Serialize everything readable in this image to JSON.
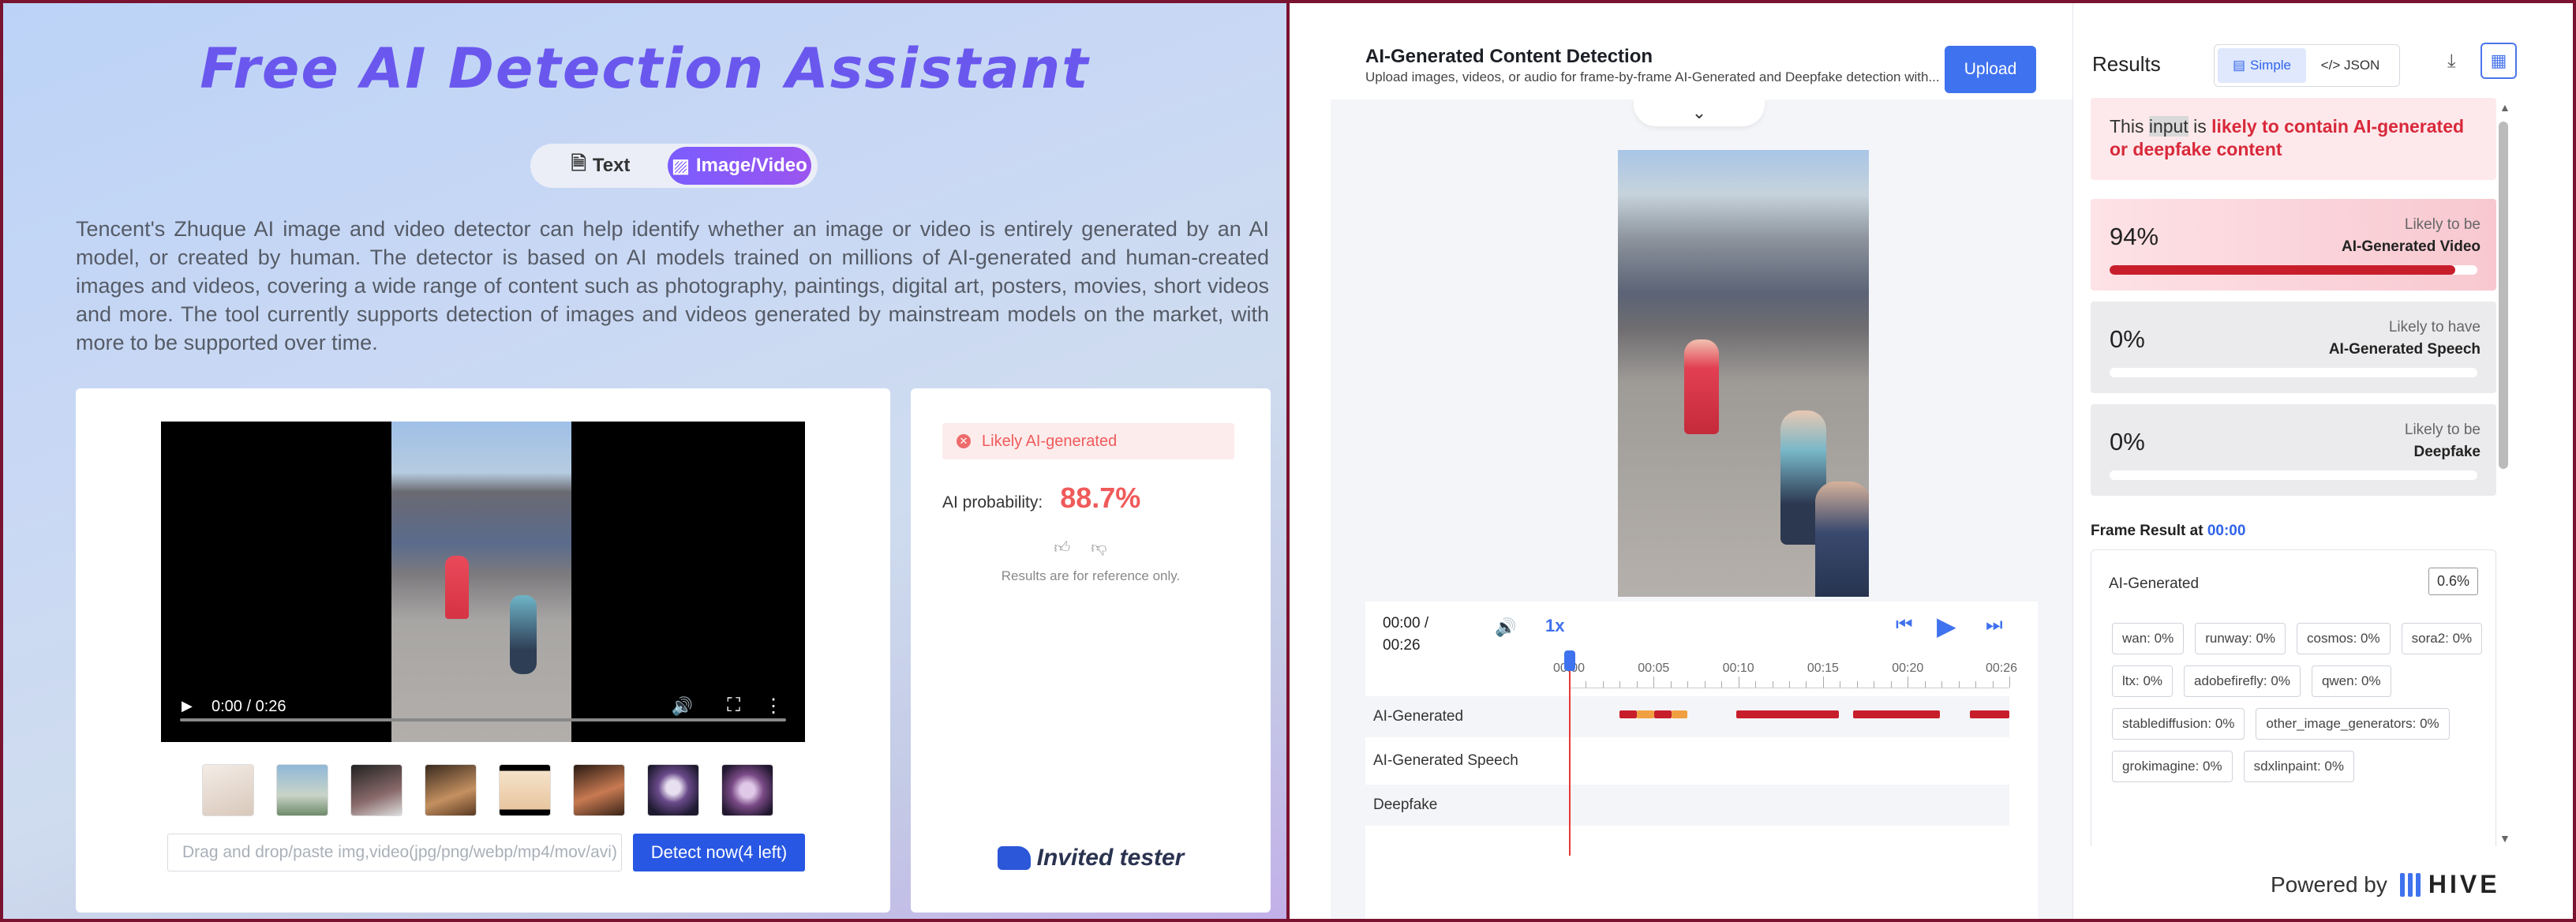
{
  "left": {
    "title": "Free AI Detection Assistant",
    "tabs": [
      {
        "label": "Text",
        "icon": "document-icon",
        "active": false
      },
      {
        "label": "Image/Video",
        "icon": "image-icon",
        "active": true
      }
    ],
    "description": "Tencent's Zhuque AI image and video detector can help identify whether an image or video is entirely generated by an AI model, or created by human. The detector is based on AI models trained on millions of AI-generated and human-created images and videos, covering a wide range of content such as photography, paintings, digital art, posters, movies, short videos and more. The tool currently supports detection of images and videos generated by mainstream models on the market, with more to be supported over time.",
    "video": {
      "time": "0:00 / 0:26"
    },
    "thumbnails_count": 8,
    "dropzone_placeholder": "Drag and drop/paste img,video(jpg/png/webp/mp4/mov/avi)",
    "detect_button": "Detect now(4 left)",
    "result": {
      "badge": "Likely AI-generated",
      "prob_label": "AI probability:",
      "prob_value": "88.7%",
      "note": "Results are for reference only.",
      "invited": "Invited tester"
    }
  },
  "right": {
    "app_title": "AI-Generated Content Detection",
    "app_subtitle": "Upload images, videos, or audio for frame-by-frame AI-Generated and Deepfake detection with...",
    "upload_button": "Upload",
    "player": {
      "time_current": "00:00 /",
      "time_total": "00:26",
      "speed": "1x",
      "ticks": [
        "00:00",
        "00:05",
        "00:10",
        "00:15",
        "00:20",
        "00:26"
      ],
      "tracks": [
        "AI-Generated",
        "AI-Generated Speech",
        "Deepfake"
      ]
    },
    "results": {
      "title": "Results",
      "toggle": [
        "Simple",
        "</> JSON"
      ],
      "verdict_pre": "This ",
      "verdict_hl": "input",
      "verdict_mid": " is ",
      "verdict_red": "likely to contain AI-generated or deepfake content",
      "metrics": [
        {
          "value": "94%",
          "line1": "Likely to be",
          "line2": "AI-Generated Video",
          "fraction": 0.94
        },
        {
          "value": "0%",
          "line1": "Likely to have",
          "line2": "AI-Generated Speech",
          "fraction": 0
        },
        {
          "value": "0%",
          "line1": "Likely to be",
          "line2": "Deepfake",
          "fraction": 0
        }
      ],
      "frame_label": "Frame Result at ",
      "frame_time": "00:00",
      "frame_box_title": "AI-Generated",
      "frame_box_value": "0.6%",
      "chips": [
        "wan: 0%",
        "runway: 0%",
        "cosmos: 0%",
        "sora2: 0%",
        "ltx: 0%",
        "adobefirefly: 0%",
        "qwen: 0%",
        "stablediffusion: 0%",
        "other_image_generators: 0%",
        "grokimagine: 0%",
        "sdxlinpaint: 0%"
      ],
      "powered_by": "Powered by",
      "brand": "HIVE"
    }
  },
  "colors": {
    "accent": "#3f72ee",
    "alert_red": "#d8293a",
    "tencent_purple": "#6a58ee"
  }
}
